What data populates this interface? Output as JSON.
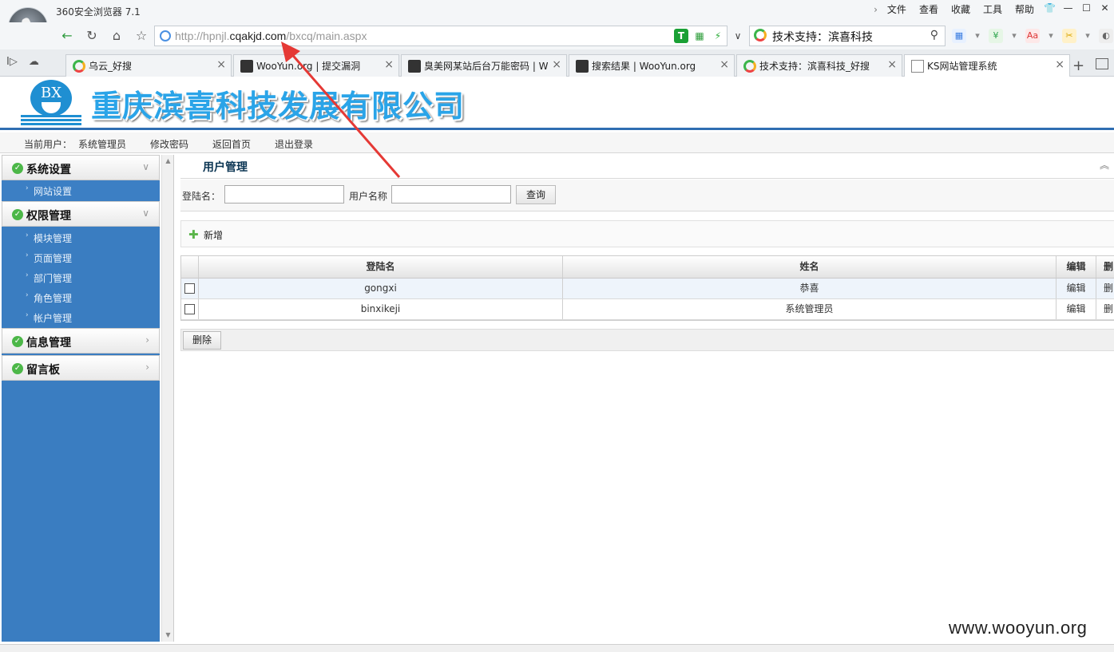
{
  "browser": {
    "title": "360安全浏览器 7.1",
    "menu": [
      "文件",
      "查看",
      "收藏",
      "工具",
      "帮助"
    ],
    "url_prefix": "http://hpnjl.",
    "url_host": "cqakjd.com",
    "url_path": "/bxcq/main.aspx",
    "search_text": "技术支持：滨喜科技",
    "tabs": [
      {
        "label": "乌云_好搜",
        "icon": "haosou-icon"
      },
      {
        "label": "WooYun.org | 提交漏洞",
        "icon": "wooyun-icon"
      },
      {
        "label": "臭美网某站后台万能密码 | W",
        "icon": "wooyun-icon"
      },
      {
        "label": "搜索结果 | WooYun.org",
        "icon": "wooyun-icon"
      },
      {
        "label": "技术支持：滨喜科技_好搜",
        "icon": "haosou-icon"
      },
      {
        "label": "KS网站管理系统",
        "icon": "page-icon"
      }
    ]
  },
  "site": {
    "logo_text": "BX",
    "company": "重庆滨喜科技发展有限公司",
    "userbar": {
      "current_user_label": "当前用户：",
      "current_user": "系统管理员",
      "change_password": "修改密码",
      "home": "返回首页",
      "logout": "退出登录"
    }
  },
  "sidebar": {
    "groups": [
      {
        "label": "系统设置",
        "items": [
          "网站设置"
        ]
      },
      {
        "label": "权限管理",
        "items": [
          "模块管理",
          "页面管理",
          "部门管理",
          "角色管理",
          "帐户管理"
        ]
      },
      {
        "label": "信息管理",
        "items": []
      },
      {
        "label": "留言板",
        "items": []
      }
    ]
  },
  "main": {
    "title": "用户管理",
    "filter": {
      "login_label": "登陆名：",
      "name_label": "用户名称",
      "login_value": "",
      "name_value": "",
      "query_button": "查询"
    },
    "add_button": "新增",
    "table": {
      "columns": [
        "登陆名",
        "姓名",
        "编辑",
        "删"
      ],
      "rows": [
        {
          "login": "gongxi",
          "name": "恭喜",
          "edit": "编辑",
          "del": "删"
        },
        {
          "login": "binxikeji",
          "name": "系统管理员",
          "edit": "编辑",
          "del": "删"
        }
      ]
    },
    "delete_button": "删除"
  },
  "watermark": "www.wooyun.org",
  "colors": {
    "sidebar_bg": "#3a7dc1",
    "company_text": "#2aa4e8",
    "annotation_arrow": "#e53935"
  }
}
